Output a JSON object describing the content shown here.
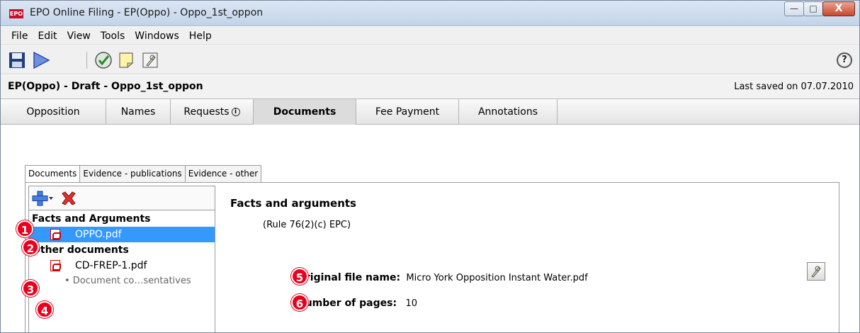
{
  "window": {
    "app_icon": "EPO",
    "title": "EPO Online Filing - EP(Oppo) - Oppo_1st_oppon",
    "buttons": {
      "minimize": "—",
      "maximize": "□",
      "close": "X"
    }
  },
  "menu": [
    "File",
    "Edit",
    "View",
    "Tools",
    "Windows",
    "Help"
  ],
  "toolbar": {
    "icons": [
      "save-icon",
      "send-icon",
      "validate-icon",
      "note-icon",
      "sign-icon"
    ],
    "help": "?"
  },
  "document_bar": {
    "title": "EP(Oppo) - Draft - Oppo_1st_oppon",
    "last_saved": "Last saved on 07.07.2010"
  },
  "main_tabs": [
    {
      "label": "Opposition"
    },
    {
      "label": "Names"
    },
    {
      "label": "Requests",
      "info_icon": "i"
    },
    {
      "label": "Documents",
      "active": true
    },
    {
      "label": "Fee Payment"
    },
    {
      "label": "Annotations"
    }
  ],
  "sub_tabs": [
    {
      "label": "Documents",
      "active": true
    },
    {
      "label": "Evidence - publications"
    },
    {
      "label": "Evidence - other"
    }
  ],
  "tree": {
    "groups": [
      {
        "label": "Facts and Arguments",
        "files": [
          {
            "name": "OPPO.pdf",
            "selected": true
          }
        ]
      },
      {
        "label": "Other documents",
        "files": [
          {
            "name": "CD-FREP-1.pdf",
            "sub": "• Document co…sentatives"
          }
        ]
      }
    ]
  },
  "detail": {
    "title": "Facts and arguments",
    "rule": "(Rule 76(2)(c) EPC)",
    "original_file_name_label": "Original file name:",
    "original_file_name": "Micro York Opposition Instant Water.pdf",
    "pages_label": "Number of pages:",
    "pages": "10"
  },
  "badges": [
    "1",
    "2",
    "3",
    "4",
    "5",
    "6"
  ],
  "colors": {
    "selection": "#3399ff",
    "badge": "#e8001c",
    "pdf": "#cc0000"
  }
}
